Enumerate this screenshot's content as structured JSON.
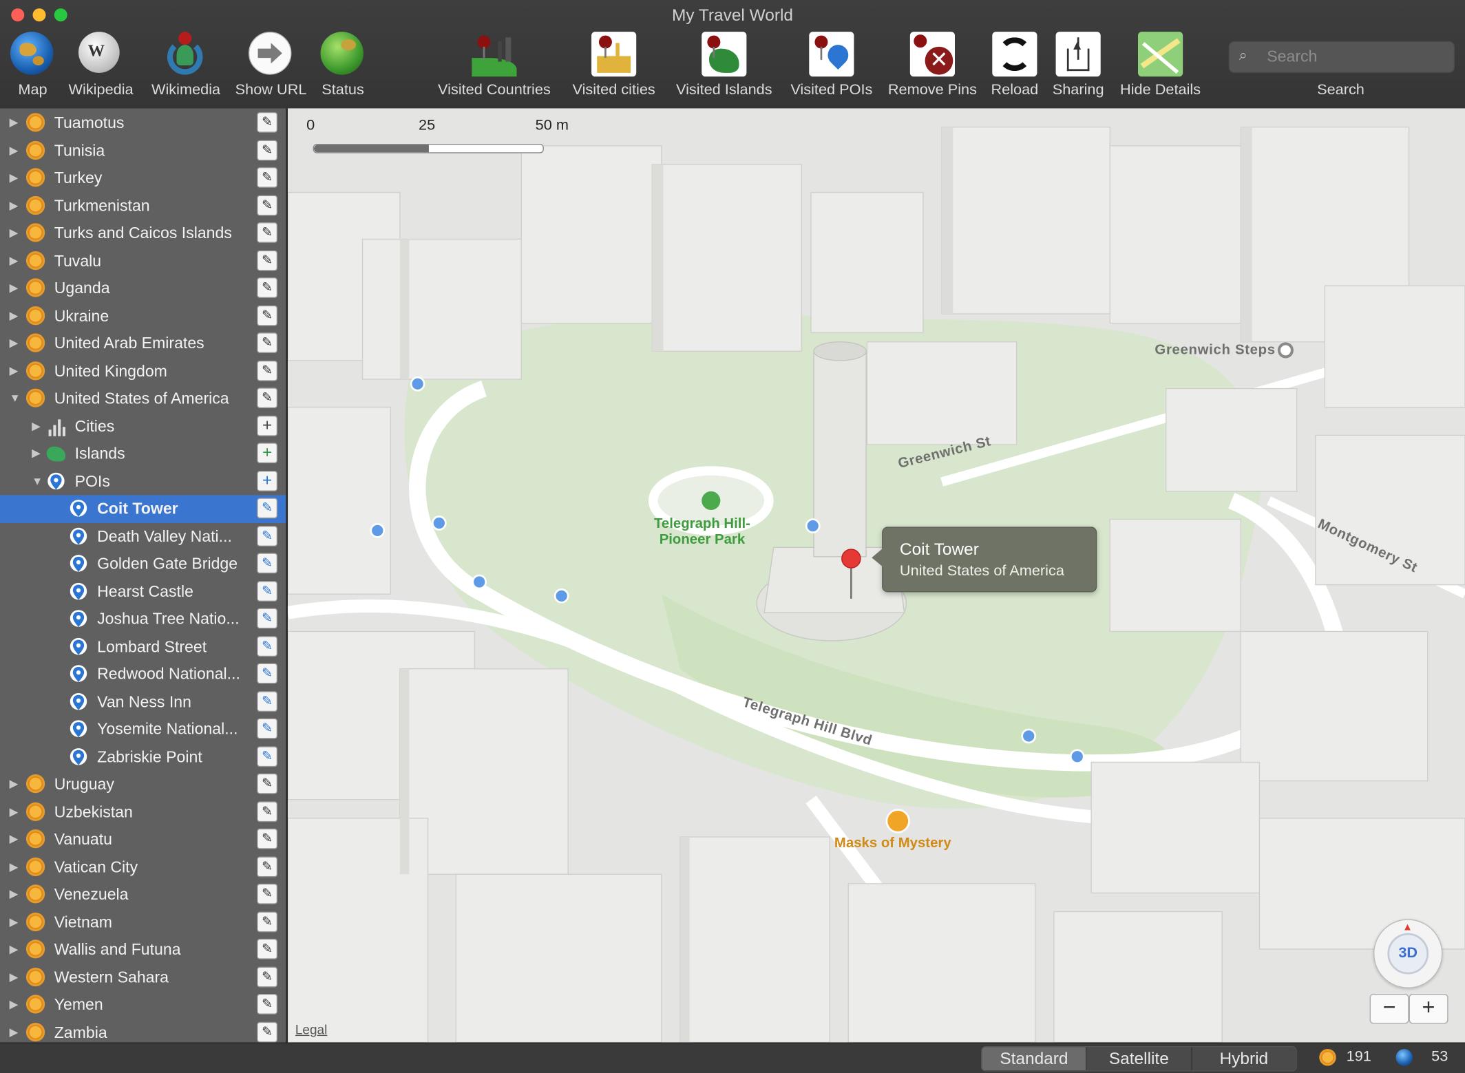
{
  "window": {
    "title": "My Travel World"
  },
  "toolbar": {
    "items": [
      {
        "label": "Map",
        "icon": "globe-map-icon"
      },
      {
        "label": "Wikipedia",
        "icon": "wikipedia-globe-icon"
      },
      {
        "label": "Wikimedia",
        "icon": "wikimedia-icon"
      },
      {
        "label": "Show URL",
        "icon": "arrow-right-icon"
      },
      {
        "label": "Status",
        "icon": "status-globe-icon"
      },
      {
        "label": "Visited Countries",
        "icon": "visited-countries-icon"
      },
      {
        "label": "Visited cities",
        "icon": "visited-cities-icon"
      },
      {
        "label": "Visited Islands",
        "icon": "visited-islands-icon"
      },
      {
        "label": "Visited POIs",
        "icon": "visited-pois-icon"
      },
      {
        "label": "Remove Pins",
        "icon": "remove-pins-icon"
      },
      {
        "label": "Reload",
        "icon": "reload-icon"
      },
      {
        "label": "Sharing",
        "icon": "share-icon"
      },
      {
        "label": "Hide Details",
        "icon": "hide-details-icon"
      }
    ],
    "search": {
      "placeholder": "Search",
      "label": "Search"
    }
  },
  "sidebar": {
    "rows": [
      {
        "label": "Tuamotus",
        "level": 0,
        "type": "country",
        "disclosure": "closed"
      },
      {
        "label": "Tunisia",
        "level": 0,
        "type": "country",
        "disclosure": "closed"
      },
      {
        "label": "Turkey",
        "level": 0,
        "type": "country",
        "disclosure": "closed"
      },
      {
        "label": "Turkmenistan",
        "level": 0,
        "type": "country",
        "disclosure": "closed"
      },
      {
        "label": "Turks and Caicos Islands",
        "level": 0,
        "type": "country",
        "disclosure": "closed"
      },
      {
        "label": "Tuvalu",
        "level": 0,
        "type": "country",
        "disclosure": "closed"
      },
      {
        "label": "Uganda",
        "level": 0,
        "type": "country",
        "disclosure": "closed"
      },
      {
        "label": "Ukraine",
        "level": 0,
        "type": "country",
        "disclosure": "closed"
      },
      {
        "label": "United Arab Emirates",
        "level": 0,
        "type": "country",
        "disclosure": "closed"
      },
      {
        "label": "United Kingdom",
        "level": 0,
        "type": "country",
        "disclosure": "closed"
      },
      {
        "label": "United States of America",
        "level": 0,
        "type": "country",
        "disclosure": "open"
      },
      {
        "label": "Cities",
        "level": 1,
        "type": "cities",
        "disclosure": "closed"
      },
      {
        "label": "Islands",
        "level": 1,
        "type": "islands",
        "disclosure": "closed"
      },
      {
        "label": "POIs",
        "level": 1,
        "type": "pois",
        "disclosure": "open"
      },
      {
        "label": "Coit Tower",
        "level": 2,
        "type": "poi",
        "selected": true
      },
      {
        "label": "Death Valley Nati...",
        "level": 2,
        "type": "poi"
      },
      {
        "label": "Golden Gate Bridge",
        "level": 2,
        "type": "poi"
      },
      {
        "label": "Hearst Castle",
        "level": 2,
        "type": "poi"
      },
      {
        "label": "Joshua Tree Natio...",
        "level": 2,
        "type": "poi"
      },
      {
        "label": "Lombard Street",
        "level": 2,
        "type": "poi"
      },
      {
        "label": "Redwood National...",
        "level": 2,
        "type": "poi"
      },
      {
        "label": "Van Ness Inn",
        "level": 2,
        "type": "poi"
      },
      {
        "label": "Yosemite National...",
        "level": 2,
        "type": "poi"
      },
      {
        "label": "Zabriskie Point",
        "level": 2,
        "type": "poi"
      },
      {
        "label": "Uruguay",
        "level": 0,
        "type": "country",
        "disclosure": "closed"
      },
      {
        "label": "Uzbekistan",
        "level": 0,
        "type": "country",
        "disclosure": "closed"
      },
      {
        "label": "Vanuatu",
        "level": 0,
        "type": "country",
        "disclosure": "closed"
      },
      {
        "label": "Vatican City",
        "level": 0,
        "type": "country",
        "disclosure": "closed"
      },
      {
        "label": "Venezuela",
        "level": 0,
        "type": "country",
        "disclosure": "closed"
      },
      {
        "label": "Vietnam",
        "level": 0,
        "type": "country",
        "disclosure": "closed"
      },
      {
        "label": "Wallis and Futuna",
        "level": 0,
        "type": "country",
        "disclosure": "closed"
      },
      {
        "label": "Western Sahara",
        "level": 0,
        "type": "country",
        "disclosure": "closed"
      },
      {
        "label": "Yemen",
        "level": 0,
        "type": "country",
        "disclosure": "closed"
      },
      {
        "label": "Zambia",
        "level": 0,
        "type": "country",
        "disclosure": "closed"
      }
    ]
  },
  "map": {
    "scale": {
      "t0": "0",
      "t1": "25",
      "t2": "50 m"
    },
    "streets": {
      "greenwich": "Greenwich St",
      "montgomery": "Montgomery St",
      "telegraph": "Telegraph Hill Blvd",
      "steps": "Greenwich Steps"
    },
    "pois": {
      "park_line1": "Telegraph Hill-",
      "park_line2": "Pioneer Park",
      "masks": "Masks of Mystery"
    },
    "callout": {
      "title": "Coit Tower",
      "subtitle": "United States of America"
    },
    "legal": "Legal",
    "compass_label": "3D",
    "zoom_out": "−",
    "zoom_in": "+"
  },
  "statusbar": {
    "modes": [
      "Standard",
      "Satellite",
      "Hybrid"
    ],
    "active_mode": "Standard",
    "visited_count": "191",
    "globe_count": "53"
  },
  "colors": {
    "selection": "#3a75cf",
    "pin": "#e53935",
    "accent_orange": "#e79d2b"
  }
}
